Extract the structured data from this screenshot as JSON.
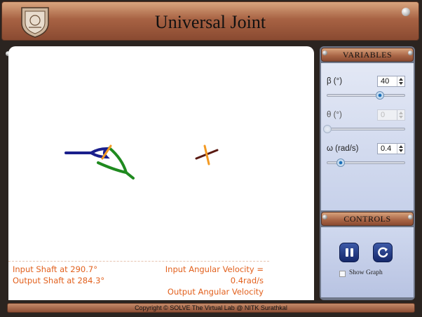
{
  "header": {
    "title": "Universal Joint"
  },
  "readouts": {
    "input_shaft": "Input Shaft at 290.7°",
    "output_shaft": "Output Shaft at 284.3°",
    "input_angular_velocity_line1": "Input Angular Velocity =",
    "input_angular_velocity_line2": "0.4rad/s",
    "output_angular_velocity_line1": "Output Angular Velocity"
  },
  "variables": {
    "title": "VARIABLES",
    "beta": {
      "label": "β (°)",
      "value": "40",
      "slider_fraction": 0.67
    },
    "theta": {
      "label": "θ (°)",
      "value": "0",
      "slider_fraction": 0.0
    },
    "omega": {
      "label": "ω (rad/s)",
      "value": "0.4",
      "slider_fraction": 0.17
    }
  },
  "controls": {
    "title": "CONTROLS",
    "pause_icon": "pause-icon",
    "reset_icon": "reset-icon",
    "show_graph_label": "Show Graph",
    "show_graph_checked": false
  },
  "footer": {
    "copyright": "Copyright © SOLVE The Virtual Lab @ NITK Surathkal"
  },
  "colors": {
    "input_shaft": "#1a1f8c",
    "output_yoke": "#1f8a1f",
    "cross_pin": "#f39a23",
    "cross_arm": "#5a1a12",
    "readout_text": "#e2611e"
  }
}
